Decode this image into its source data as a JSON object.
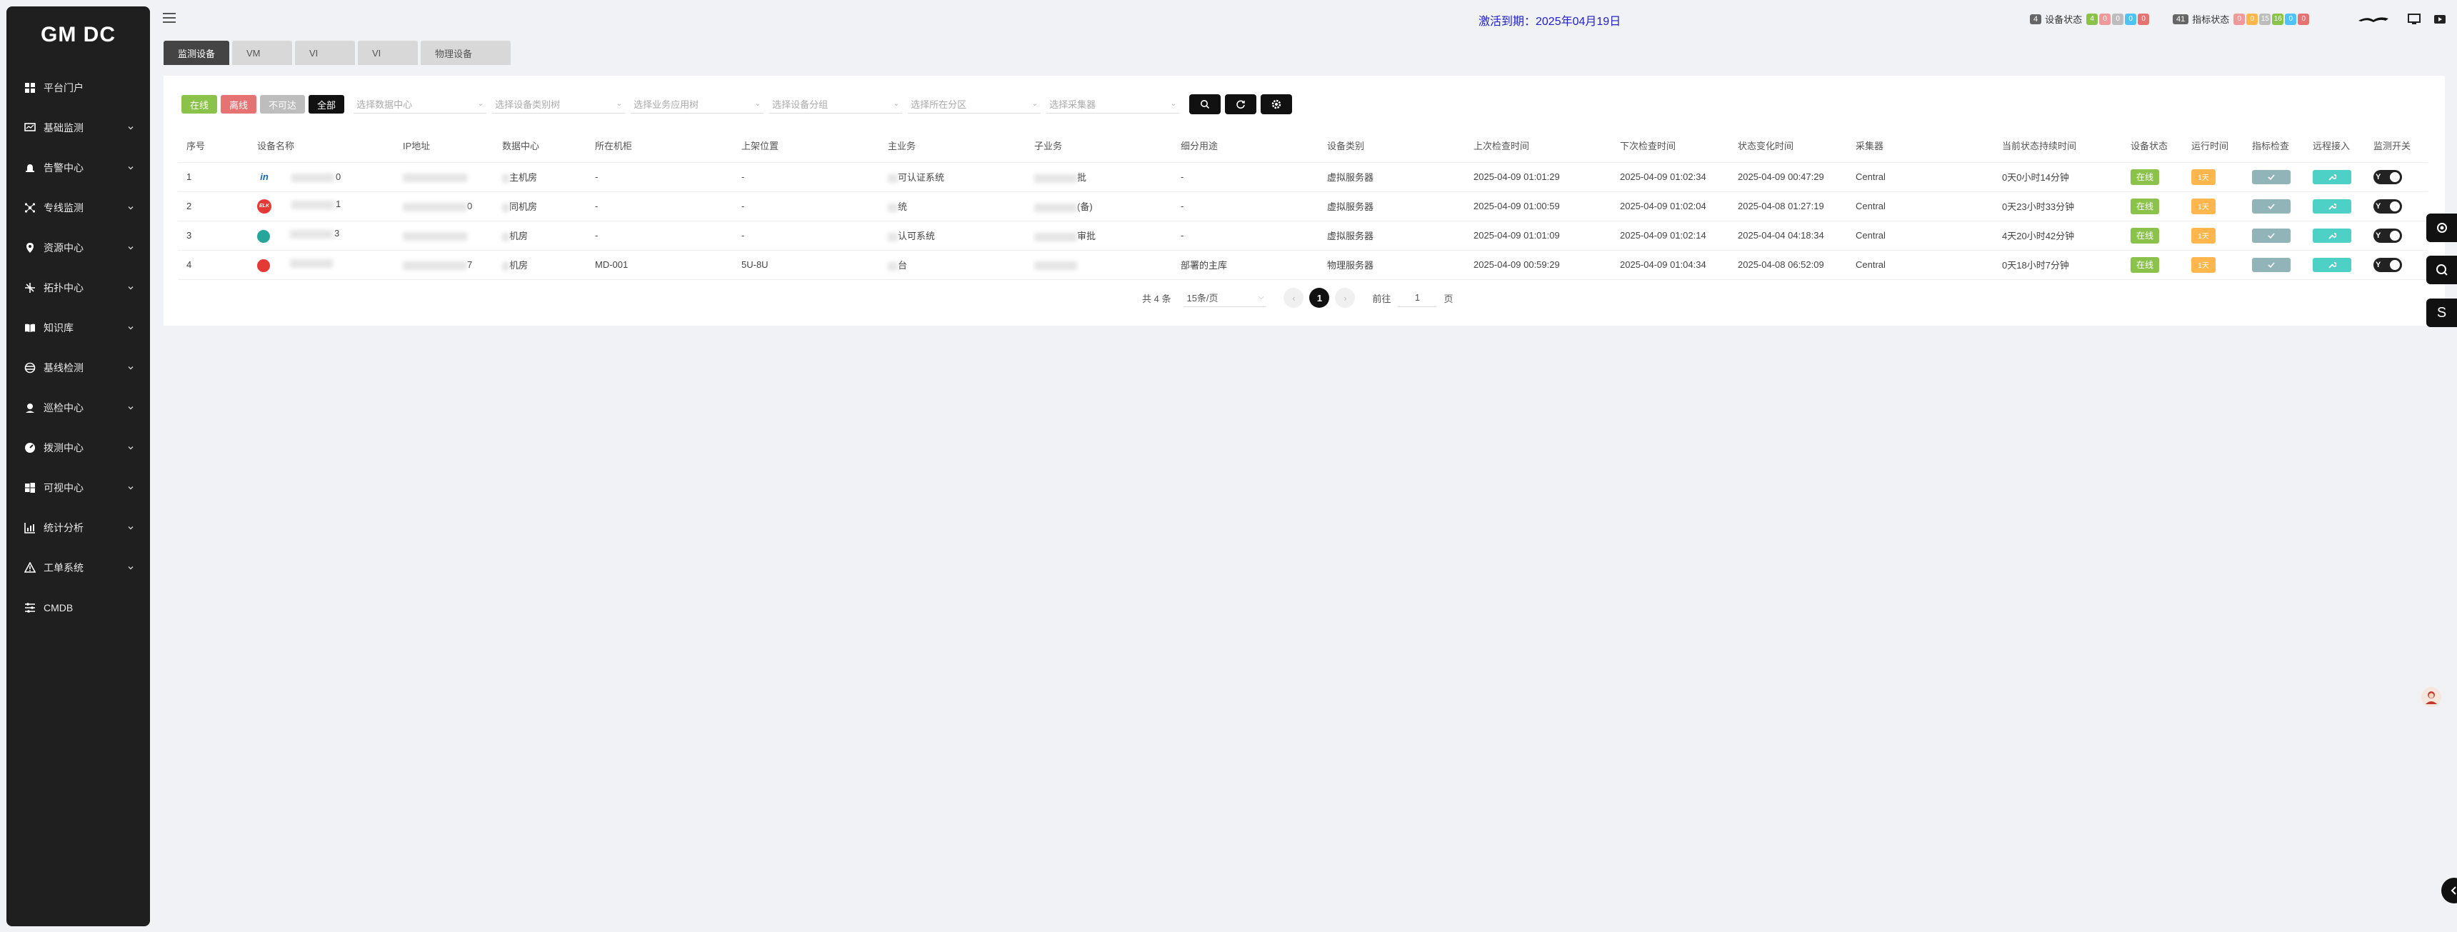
{
  "sidebar": {
    "title": "GM DC",
    "items": [
      {
        "label": "平台门户",
        "icon": "grid-icon",
        "chevron": false
      },
      {
        "label": "基础监测",
        "icon": "monitor-icon",
        "chevron": true
      },
      {
        "label": "告警中心",
        "icon": "alarm-icon",
        "chevron": true
      },
      {
        "label": "专线监测",
        "icon": "network-icon",
        "chevron": true
      },
      {
        "label": "资源中心",
        "icon": "location-icon",
        "chevron": true
      },
      {
        "label": "拓扑中心",
        "icon": "topology-icon",
        "chevron": true
      },
      {
        "label": "知识库",
        "icon": "book-icon",
        "chevron": true
      },
      {
        "label": "基线检测",
        "icon": "baseline-icon",
        "chevron": true
      },
      {
        "label": "巡检中心",
        "icon": "inspect-icon",
        "chevron": true
      },
      {
        "label": "拨测中心",
        "icon": "dial-icon",
        "chevron": true
      },
      {
        "label": "可视中心",
        "icon": "windows-icon",
        "chevron": true
      },
      {
        "label": "统计分析",
        "icon": "chart-icon",
        "chevron": true
      },
      {
        "label": "工单系统",
        "icon": "warning-icon",
        "chevron": true
      },
      {
        "label": "CMDB",
        "icon": "sliders-icon",
        "chevron": false
      }
    ]
  },
  "header": {
    "activation": "激活到期：2025年04月19日",
    "device_status": {
      "lead": "4",
      "label": "设备状态",
      "counts": [
        "4",
        "0",
        "0",
        "0",
        "0"
      ],
      "colors": [
        "#8bc34a",
        "#ef9a9a",
        "#bdbdbd",
        "#4fc3f7",
        "#e57373"
      ]
    },
    "metric_status": {
      "lead": "41",
      "label": "指标状态",
      "counts": [
        "0",
        "0",
        "15",
        "16",
        "0",
        "0"
      ],
      "colors": [
        "#ef9a9a",
        "#ffb74d",
        "#bdbdbd",
        "#8bc34a",
        "#4fc3f7",
        "#e57373"
      ]
    }
  },
  "tabs": [
    "监测设备",
    "VM",
    "VI",
    "VI",
    "物理设备"
  ],
  "filters": {
    "pills": [
      {
        "label": "在线",
        "color": "#8bc34a"
      },
      {
        "label": "离线",
        "color": "#e57373"
      },
      {
        "label": "不可达",
        "color": "#bdbdbd"
      },
      {
        "label": "全部",
        "color": "#111111"
      }
    ],
    "selects": [
      "选择数据中心",
      "选择设备类别树",
      "选择业务应用树",
      "选择设备分组",
      "选择所在分区",
      "选择采集器"
    ]
  },
  "table": {
    "headers": [
      "序号",
      "设备名称",
      "IP地址",
      "数据中心",
      "所在机柜",
      "上架位置",
      "主业务",
      "子业务",
      "细分用途",
      "设备类别",
      "上次检查时间",
      "下次检查时间",
      "状态变化时间",
      "采集器",
      "当前状态持续时间",
      "设备状态",
      "运行时间",
      "指标检查",
      "远程接入",
      "监测开关"
    ],
    "rows": [
      {
        "idx": "1",
        "brand": "in",
        "brand_color": "#1565c0",
        "name": "0",
        "ip": "",
        "dc": "主机房",
        "rack": "-",
        "pos": "-",
        "main": "可认证系统",
        "sub": "批",
        "usage": "-",
        "type": "虚拟服务器",
        "last": "2025-04-09 01:01:29",
        "next": "2025-04-09 01:02:34",
        "change": "2025-04-09 00:47:29",
        "collector": "Central",
        "duration": "0天0小时14分钟",
        "status": "在线",
        "uptime": "1天",
        "toggle": "Y"
      },
      {
        "idx": "2",
        "brand": "ELK",
        "brand_color": "#e53935",
        "name": "1",
        "ip": "0",
        "dc": "同机房",
        "rack": "-",
        "pos": "-",
        "main": "统",
        "sub": "(备)",
        "usage": "-",
        "type": "虚拟服务器",
        "last": "2025-04-09 01:00:59",
        "next": "2025-04-09 01:02:04",
        "change": "2025-04-08 01:27:19",
        "collector": "Central",
        "duration": "0天23小时33分钟",
        "status": "在线",
        "uptime": "1天",
        "toggle": "Y"
      },
      {
        "idx": "3",
        "brand": "",
        "brand_color": "#26a69a",
        "name": "3",
        "ip": "",
        "dc": "机房",
        "rack": "-",
        "pos": "-",
        "main": "认可系统",
        "sub": "审批",
        "usage": "-",
        "type": "虚拟服务器",
        "last": "2025-04-09 01:01:09",
        "next": "2025-04-09 01:02:14",
        "change": "2025-04-04 04:18:34",
        "collector": "Central",
        "duration": "4天20小时42分钟",
        "status": "在线",
        "uptime": "1天",
        "toggle": "Y"
      },
      {
        "idx": "4",
        "brand": "",
        "brand_color": "#e53935",
        "name": "",
        "ip": "7",
        "dc": "机房",
        "rack": "MD-001",
        "pos": "5U-8U",
        "main": "台",
        "sub": "",
        "usage": "部署的主库",
        "type": "物理服务器",
        "last": "2025-04-09 00:59:29",
        "next": "2025-04-09 01:04:34",
        "change": "2025-04-08 06:52:09",
        "collector": "Central",
        "duration": "0天18小时7分钟",
        "status": "在线",
        "uptime": "1天",
        "toggle": "Y"
      }
    ]
  },
  "pager": {
    "total": "共 4 条",
    "size": "15条/页",
    "current": "1",
    "goto_label": "前往",
    "goto_value": "1",
    "page_suffix": "页"
  },
  "floating": [
    "S"
  ]
}
